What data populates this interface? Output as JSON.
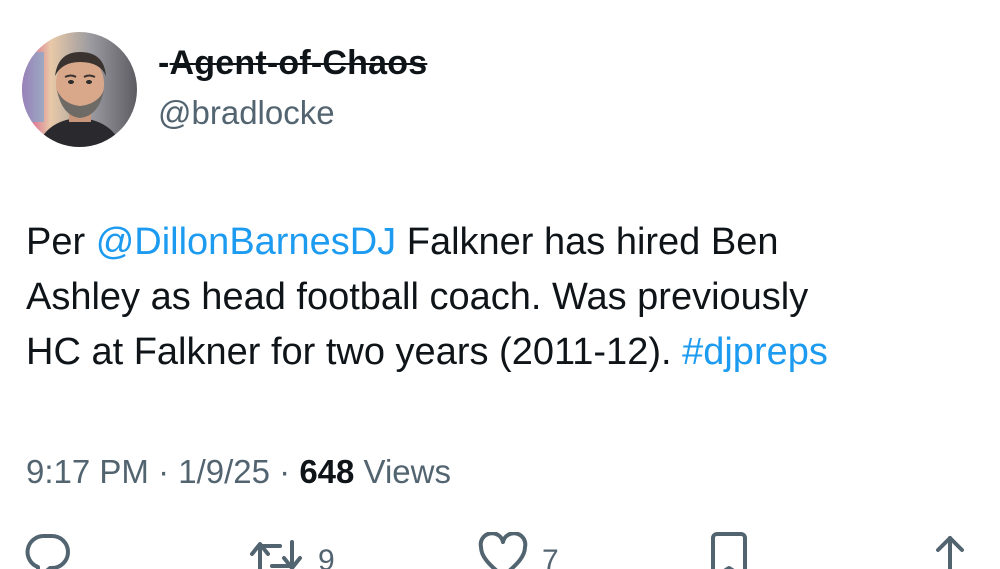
{
  "user": {
    "display_prefix": "-",
    "display_name": "Agent-of-Chaos",
    "handle": "@bradlocke",
    "avatar": "avatar-photo"
  },
  "tweet": {
    "lines": [
      [
        {
          "text": "Per ",
          "type": "text"
        },
        {
          "text": "@DillonBarnesDJ",
          "type": "mention"
        },
        {
          "text": " Falkner has hired Ben",
          "type": "text"
        }
      ],
      [
        {
          "text": "Ashley as head football coach. Was previously",
          "type": "text"
        }
      ],
      [
        {
          "text": "HC at Falkner for two years (2011-12). ",
          "type": "text"
        },
        {
          "text": "#djpreps",
          "type": "hashtag"
        }
      ]
    ]
  },
  "meta": {
    "time": "9:17 PM",
    "sep1": " · ",
    "date": "1/9/25",
    "sep2": " · ",
    "views_count": "648",
    "views_label": " Views"
  },
  "actions": {
    "reply_icon": "reply-icon",
    "retweet_icon": "retweet-icon",
    "retweet_count": "9",
    "like_icon": "heart-icon",
    "like_count": "7",
    "bookmark_icon": "bookmark-icon",
    "share_icon": "share-icon"
  },
  "colors": {
    "link": "#1d9bf0",
    "secondary_text": "#536471",
    "primary_text": "#0f1419"
  }
}
